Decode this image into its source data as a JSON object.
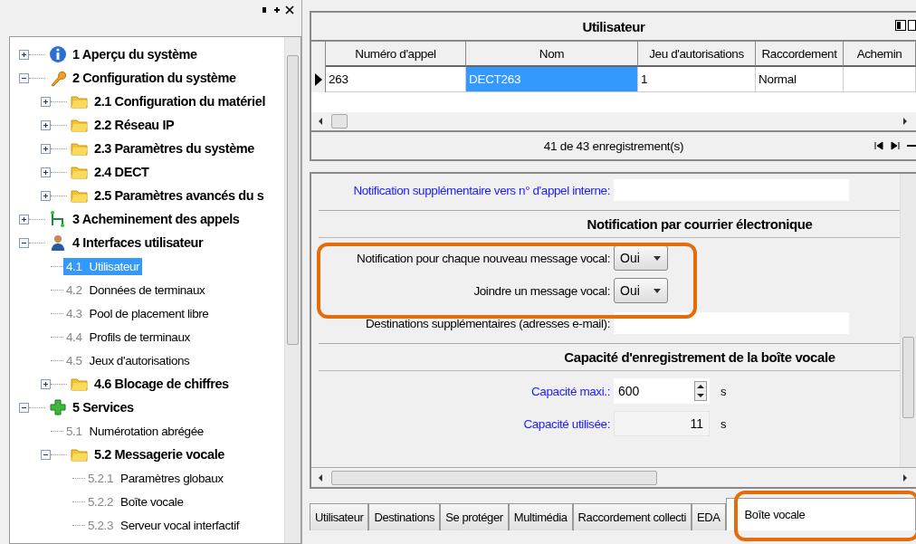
{
  "tree_panel": {
    "items": [
      {
        "kind": "info",
        "label": "1 Aperçu du système",
        "expanded": false,
        "selected": false
      },
      {
        "kind": "wrench",
        "label": "2 Configuration du système",
        "expanded": true,
        "selected": false,
        "children": [
          {
            "kind": "folder",
            "label": "2.1 Configuration du matériel",
            "expanded": false,
            "selected": false
          },
          {
            "kind": "folder",
            "label": "2.2 Réseau IP",
            "expanded": false,
            "selected": false
          },
          {
            "kind": "folder",
            "label": "2.3 Paramètres du système",
            "expanded": false,
            "selected": false
          },
          {
            "kind": "folder",
            "label": "2.4 DECT",
            "expanded": false,
            "selected": false
          },
          {
            "kind": "folder",
            "label": "2.5 Paramètres avancés du s",
            "expanded": false,
            "selected": false
          }
        ]
      },
      {
        "kind": "routing",
        "label": "3 Acheminement des appels",
        "expanded": false,
        "selected": false
      },
      {
        "kind": "user",
        "label": "4 Interfaces utilisateur",
        "expanded": true,
        "selected": false,
        "children": [
          {
            "kind": "leaf",
            "number": "4.1",
            "label": "Utilisateur",
            "selected": true
          },
          {
            "kind": "leaf",
            "number": "4.2",
            "label": "Données de terminaux",
            "selected": false
          },
          {
            "kind": "leaf",
            "number": "4.3",
            "label": "Pool de placement libre",
            "selected": false
          },
          {
            "kind": "leaf",
            "number": "4.4",
            "label": "Profils de terminaux",
            "selected": false
          },
          {
            "kind": "leaf",
            "number": "4.5",
            "label": "Jeux d'autorisations",
            "selected": false
          },
          {
            "kind": "folder",
            "label": "4.6 Blocage de chiffres",
            "expanded": false,
            "selected": false
          }
        ]
      },
      {
        "kind": "services",
        "label": "5 Services",
        "expanded": true,
        "selected": false,
        "children": [
          {
            "kind": "leaf",
            "number": "5.1",
            "label": "Numérotation abrégée",
            "selected": false
          },
          {
            "kind": "folder",
            "label": "5.2 Messagerie vocale",
            "expanded": true,
            "selected": false,
            "children": [
              {
                "kind": "leaf",
                "number": "5.2.1",
                "label": "Paramètres globaux",
                "selected": false
              },
              {
                "kind": "leaf",
                "number": "5.2.2",
                "label": "Boîte vocale",
                "selected": false
              },
              {
                "kind": "leaf",
                "number": "5.2.3",
                "label": "Serveur vocal interfactif",
                "selected": false
              }
            ]
          }
        ]
      }
    ]
  },
  "grid": {
    "title": "Utilisateur",
    "columns": [
      "Numéro d'appel",
      "Nom",
      "Jeu d'autorisations",
      "Raccordement",
      "Achemin"
    ],
    "rows": [
      {
        "current": true,
        "cells": [
          {
            "text": "263",
            "selected": false
          },
          {
            "text": "DECT263",
            "selected": true
          },
          {
            "text": "1",
            "selected": false
          },
          {
            "text": "Normal",
            "selected": false
          },
          {
            "text": "",
            "selected": false
          }
        ]
      }
    ],
    "status": "41 de 43 enregistrement(s)"
  },
  "form": {
    "sections": [
      {
        "rows": [
          {
            "kind": "text",
            "label": "Notification supplémentaire vers n° d'appel interne:",
            "emphasis": true
          }
        ]
      },
      {
        "title": "Notification par courrier électronique",
        "rows": [
          {
            "kind": "select",
            "label": "Notification pour chaque nouveau message vocal:",
            "value": "Oui",
            "emphasis": false
          },
          {
            "kind": "select",
            "label": "Joindre un message vocal:",
            "value": "Oui",
            "emphasis": false
          },
          {
            "kind": "text",
            "label": "Destinations supplémentaires (adresses e-mail):",
            "emphasis": false
          }
        ]
      },
      {
        "title": "Capacité d'enregistrement de la boîte vocale",
        "rows": [
          {
            "kind": "spinner",
            "label": "Capacité maxi.:",
            "value": "600",
            "unit": "s",
            "emphasis": true
          },
          {
            "kind": "readonly",
            "label": "Capacité utilisée:",
            "value": "11",
            "unit": "s",
            "emphasis": true
          }
        ]
      }
    ]
  },
  "tabs": [
    {
      "label": "Utilisateur",
      "selected": false
    },
    {
      "label": "Destinations",
      "selected": false
    },
    {
      "label": "Se protéger",
      "selected": false
    },
    {
      "label": "Multimédia",
      "selected": false
    },
    {
      "label": "Raccordement collecti",
      "selected": false
    },
    {
      "label": "EDA",
      "selected": false
    },
    {
      "label": "Boîte vocale",
      "selected": true
    }
  ]
}
